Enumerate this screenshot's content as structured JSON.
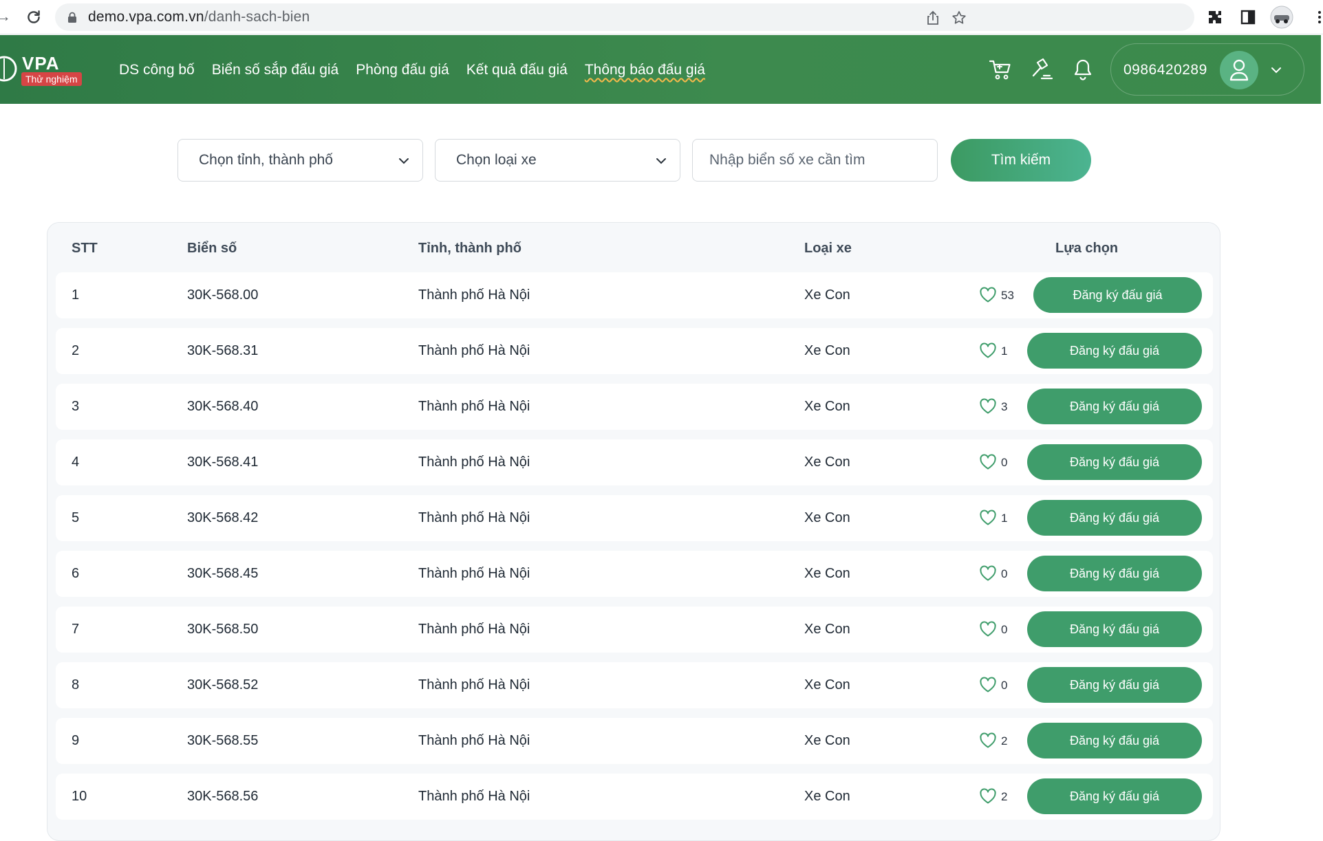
{
  "browser": {
    "url_host": "demo.vpa.com.vn",
    "url_path": "/danh-sach-bien"
  },
  "header": {
    "logo_text": "VPA",
    "logo_badge": "Thử nghiệm",
    "nav": [
      {
        "label": "DS công bố",
        "active": false
      },
      {
        "label": "Biển số sắp đấu giá",
        "active": false
      },
      {
        "label": "Phòng đấu giá",
        "active": false
      },
      {
        "label": "Kết quả đấu giá",
        "active": false
      },
      {
        "label": "Thông báo đấu giá",
        "active": true
      }
    ],
    "phone": "0986420289",
    "icons": [
      "cart-icon",
      "gavel-icon",
      "bell-icon"
    ]
  },
  "filters": {
    "province_select": "Chọn tỉnh, thành phố",
    "vehicle_select": "Chọn loại xe",
    "search_placeholder": "Nhập biển số xe cần tìm",
    "search_button": "Tìm kiếm"
  },
  "table": {
    "headers": {
      "stt": "STT",
      "plate": "Biển số",
      "province": "Tỉnh, thành phố",
      "vehicle": "Loại xe",
      "action": "Lựa chọn"
    },
    "rows": [
      {
        "stt": "1",
        "plate": "30K-568.00",
        "province": "Thành phố Hà Nội",
        "vehicle": "Xe Con",
        "likes": "53",
        "button": "Đăng ký đấu giá"
      },
      {
        "stt": "2",
        "plate": "30K-568.31",
        "province": "Thành phố Hà Nội",
        "vehicle": "Xe Con",
        "likes": "1",
        "button": "Đăng ký đấu giá"
      },
      {
        "stt": "3",
        "plate": "30K-568.40",
        "province": "Thành phố Hà Nội",
        "vehicle": "Xe Con",
        "likes": "3",
        "button": "Đăng ký đấu giá"
      },
      {
        "stt": "4",
        "plate": "30K-568.41",
        "province": "Thành phố Hà Nội",
        "vehicle": "Xe Con",
        "likes": "0",
        "button": "Đăng ký đấu giá"
      },
      {
        "stt": "5",
        "plate": "30K-568.42",
        "province": "Thành phố Hà Nội",
        "vehicle": "Xe Con",
        "likes": "1",
        "button": "Đăng ký đấu giá"
      },
      {
        "stt": "6",
        "plate": "30K-568.45",
        "province": "Thành phố Hà Nội",
        "vehicle": "Xe Con",
        "likes": "0",
        "button": "Đăng ký đấu giá"
      },
      {
        "stt": "7",
        "plate": "30K-568.50",
        "province": "Thành phố Hà Nội",
        "vehicle": "Xe Con",
        "likes": "0",
        "button": "Đăng ký đấu giá"
      },
      {
        "stt": "8",
        "plate": "30K-568.52",
        "province": "Thành phố Hà Nội",
        "vehicle": "Xe Con",
        "likes": "0",
        "button": "Đăng ký đấu giá"
      },
      {
        "stt": "9",
        "plate": "30K-568.55",
        "province": "Thành phố Hà Nội",
        "vehicle": "Xe Con",
        "likes": "2",
        "button": "Đăng ký đấu giá"
      },
      {
        "stt": "10",
        "plate": "30K-568.56",
        "province": "Thành phố Hà Nội",
        "vehicle": "Xe Con",
        "likes": "2",
        "button": "Đăng ký đấu giá"
      }
    ]
  },
  "colors": {
    "header_green": "#3b8a4c",
    "button_green": "#3f9d6b",
    "heart_green": "#3f9d6b",
    "badge_red": "#d64545"
  }
}
